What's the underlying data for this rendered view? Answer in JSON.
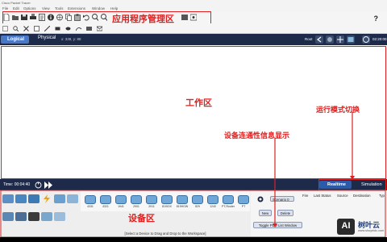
{
  "window": {
    "title": "Cisco Packet Tracer"
  },
  "menu": [
    "File",
    "Edit",
    "Options",
    "View",
    "Tools",
    "Extensions",
    "Window",
    "Help"
  ],
  "navbar": {
    "logical_label": "Logical",
    "physical_label": "Physical",
    "coords": "x: 339, y: 88",
    "root_label": "Root",
    "clock_time": "02:20:00"
  },
  "timebar": {
    "time_label": "Time: 00:04:40",
    "realtime_label": "Realtime",
    "simulation_label": "Simulation"
  },
  "devices": [
    "4331",
    "4321",
    "1941",
    "2901",
    "2911",
    "819IOX",
    "819HGW",
    "829",
    "1240",
    "PT-Router",
    "PT"
  ],
  "bottom": {
    "instruction": "[Select a Device to Drag and Drop to the Workspace]"
  },
  "pdu": {
    "scenario_label": "Scenario 0",
    "new_label": "New",
    "delete_label": "Delete",
    "toggle_label": "Toggle PDU List Window",
    "columns": [
      "Fire",
      "Last Status",
      "Source",
      "Destination",
      "Typ"
    ]
  },
  "annotations": {
    "toolbar_label": "应用程序管理区",
    "workspace_label": "工作区",
    "mode_label": "运行模式切换",
    "connectivity_label": "设备连通性信息显示",
    "device_label": "设备区"
  },
  "watermark": {
    "badge": "AI",
    "site": "树叶云",
    "url": "www.shuyeidc.com"
  },
  "colors": {
    "accent_red": "#e02020",
    "navbar_bg": "#1e2a4a",
    "logical_tab": "#4a78c8",
    "realtime_tab": "#2a5aa8",
    "router_blue": "#6fa8d8"
  }
}
